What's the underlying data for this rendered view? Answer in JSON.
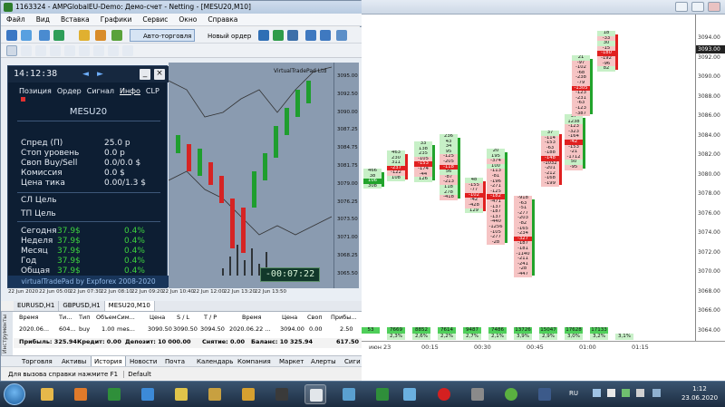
{
  "window": {
    "title": "1163324 - AMPGlobalEU-Demo: Демо-счет - Netting - [MESU20,M10]"
  },
  "menu": [
    "Файл",
    "Вид",
    "Вставка",
    "Графики",
    "Сервис",
    "Окно",
    "Справка"
  ],
  "toolbar": {
    "auto_trading": "Авто-торговля",
    "new_order": "Новый ордер"
  },
  "chart": {
    "symbol_label": "VirtualTradePad Ltd",
    "price_labels": [
      "3095.00",
      "3092.50",
      "3090.00",
      "3087.25",
      "3084.75",
      "3081.75",
      "3079.00",
      "3076.25",
      "3073.50",
      "3071.00",
      "3068.25",
      "3065.50"
    ],
    "dates": [
      "22 Jun 2020",
      "22 Jun 05:00",
      "22 Jun 07:30",
      "22 Jun 08:10",
      "22 Jun 09:20",
      "22 Jun 10:40",
      "22 Jun 12:00",
      "22 Jun 13:20",
      "22 Jun 13:50"
    ]
  },
  "pad": {
    "time": "14:12:38",
    "tabs": [
      "Позиция",
      "Ордер",
      "Сигнал",
      "Инфо",
      "CLP"
    ],
    "active_tab": "Инфо",
    "symbol": "MESU20",
    "info": [
      {
        "label": "Спред (П)",
        "value": "25.0 р"
      },
      {
        "label": "Стоп уровень",
        "value": "0.0 р"
      },
      {
        "label": "Своп Buy/Sell",
        "value": "0.0/0.0 $"
      },
      {
        "label": "Комиссия",
        "value": "0.0 $"
      },
      {
        "label": "Цена тика",
        "value": "0.00/1.3 $"
      }
    ],
    "sl": "СЛ Цель",
    "tp": "ТП Цель",
    "profits": [
      {
        "label": "Сегодня",
        "amount": "37.9$",
        "pct": "0.4%"
      },
      {
        "label": "Неделя",
        "amount": "37.9$",
        "pct": "0.4%"
      },
      {
        "label": "Месяц",
        "amount": "37.9$",
        "pct": "0.4%"
      },
      {
        "label": "Год",
        "amount": "37.9$",
        "pct": "0.4%"
      },
      {
        "label": "Общая",
        "amount": "37.9$",
        "pct": "0.4%"
      }
    ],
    "footer": "virtualTradePad by Expforex 2008-2020"
  },
  "timer": "-00:07:22",
  "symbol_tabs": [
    "EURUSD,H1",
    "GBPUSD,H1",
    "MESU20,M10"
  ],
  "terminal": {
    "side_title": "Инструменты",
    "headers": [
      "Время",
      "Ти...",
      "Тип",
      "Объем",
      "Сим...",
      "Цена",
      "S / L",
      "T / P",
      "Время",
      "Цена",
      "Своп",
      "Прибы..."
    ],
    "row": [
      "2020.06...",
      "604...",
      "buy",
      "1.00",
      "mes...",
      "3090.50",
      "3090.50",
      "3094.50",
      "2020.06.22 ...",
      "3094.00",
      "0.00",
      "2.50"
    ],
    "summary": {
      "profit": "Прибыль: 325.94",
      "credit": "Кредит: 0.00",
      "deposit": "Депозит: 10 000.00",
      "withdraw": "Снятие: 0.00",
      "balance": "Баланс: 10 325.94",
      "total": "617.50"
    }
  },
  "terminal_tabs": [
    "Торговля",
    "Активы",
    "История",
    "Новости",
    "Почта",
    "Календарь",
    "Компания",
    "Маркет",
    "Алерты",
    "Сиги"
  ],
  "terminal_active": "История",
  "status": "Для вызова справки нажмите F1",
  "status_profile": "Default",
  "footprint": {
    "price_labels": [
      "3094.00",
      "3092.00",
      "3090.00",
      "3088.00",
      "3086.00",
      "3084.00",
      "3082.00",
      "3080.00",
      "3078.00",
      "3076.00",
      "3074.00",
      "3072.00",
      "3070.00",
      "3068.00",
      "3066.00",
      "3064.00"
    ],
    "current_price": "3093.00",
    "volumes": [
      "53",
      "7669",
      "8852",
      "7614",
      "9487",
      "7486",
      "13726",
      "15047",
      "17628",
      "17133"
    ],
    "percents": [
      "2,3%",
      "2,6%",
      "2,2%",
      "2,7%",
      "2,1%",
      "3,9%",
      "2,9%",
      "3,0%",
      "3,2%",
      "3,1%"
    ],
    "times": [
      "июн 23",
      "00:15",
      "00:30",
      "00:45",
      "01:00",
      "01:15"
    ],
    "columns": [
      {
        "cells": [
          "466",
          "38",
          "106",
          "308"
        ]
      },
      {
        "cells": [
          "463",
          "230",
          "311",
          "-237",
          "-122",
          "108"
        ]
      },
      {
        "cells": [
          "33",
          "138",
          "235",
          "-105",
          "-153",
          "-174",
          "-44",
          "126"
        ]
      },
      {
        "cells": [
          "236",
          "43",
          "34",
          "95",
          "-125",
          "-205",
          "-118",
          "56",
          "-87",
          "-213",
          "118",
          "278",
          "-418"
        ]
      },
      {
        "cells": [
          "48",
          "-155",
          "-77",
          "-102",
          "-42",
          "-428",
          "129"
        ]
      },
      {
        "cells": [
          "20",
          "195",
          "-374",
          "100",
          "-113",
          "-81",
          "-196",
          "-271",
          "-125",
          "-182",
          "-471",
          "-137",
          "-187",
          "-137",
          "-440",
          "-1256",
          "-105",
          "-277",
          "-28"
        ]
      },
      {
        "cells": [
          "-918",
          "-63",
          "-51",
          "-277",
          "-203",
          "-82",
          "-165",
          "-234",
          "-327",
          "-187",
          "-181",
          "-1140",
          "-211",
          "-241",
          "-28",
          "-447"
        ]
      },
      {
        "cells": [
          "37",
          "-114",
          "-153",
          "-63",
          "-188",
          "-148",
          "-1032",
          "-201",
          "-212",
          "-168",
          "-199"
        ]
      },
      {
        "cells": [
          "37",
          "1238",
          "-123",
          "-323",
          "-164",
          "-42",
          "-153",
          "-21",
          "-1712",
          "50",
          "-95"
        ]
      },
      {
        "cells": [
          "21",
          "-97",
          "-102",
          "-68",
          "-238",
          "-79",
          "-1305",
          "-123",
          "-231",
          "-63",
          "-123",
          "-387"
        ]
      },
      {
        "cells": [
          "18",
          "-33",
          "30",
          "-15",
          "-180",
          "-192",
          "-96",
          "82"
        ]
      }
    ]
  },
  "taskbar": {
    "lang": "RU",
    "time": "1:12",
    "date": "23.06.2020"
  }
}
